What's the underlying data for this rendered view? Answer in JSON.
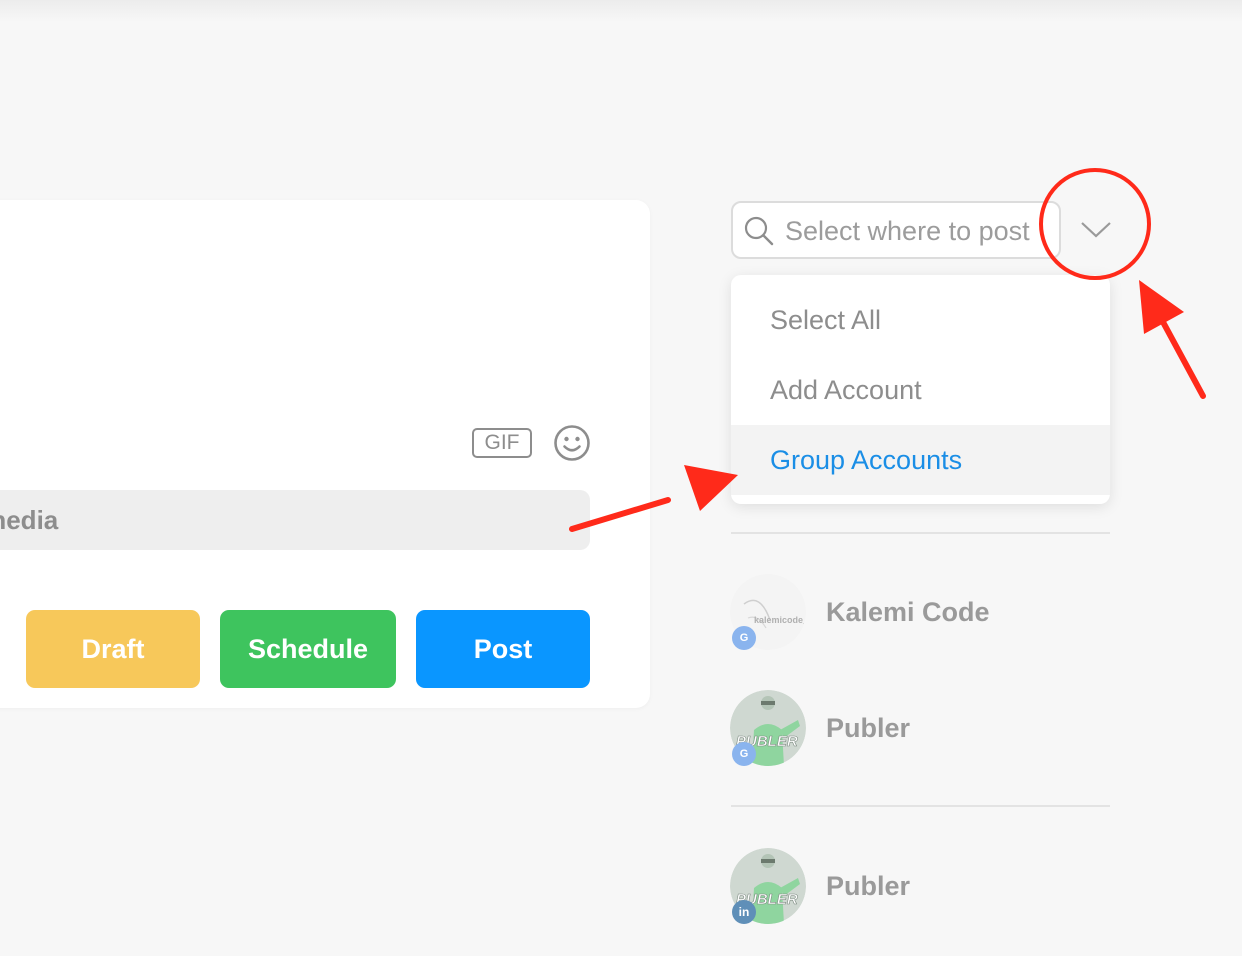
{
  "composer": {
    "gif_label": "GIF",
    "media_text": "p media",
    "buttons": {
      "draft": "Draft",
      "schedule": "Schedule",
      "post": "Post"
    }
  },
  "picker": {
    "placeholder": "Select where to post",
    "dropdown": [
      {
        "label": "Select All"
      },
      {
        "label": "Add Account"
      },
      {
        "label": "Group Accounts",
        "active": true
      }
    ]
  },
  "accounts": [
    {
      "name": "Kalemi Code",
      "network": "google-business",
      "avatar_text": "kalemicode_"
    },
    {
      "name": "Publer",
      "network": "google-business",
      "avatar_text": "PUBLER"
    },
    {
      "name": "Publer",
      "network": "linkedin",
      "avatar_text": "PUBLER"
    }
  ],
  "colors": {
    "draft": "#f7c85a",
    "schedule": "#3ec45e",
    "post": "#0a96ff",
    "active_link": "#1a8ee6",
    "annotation": "#ff2a1a"
  }
}
